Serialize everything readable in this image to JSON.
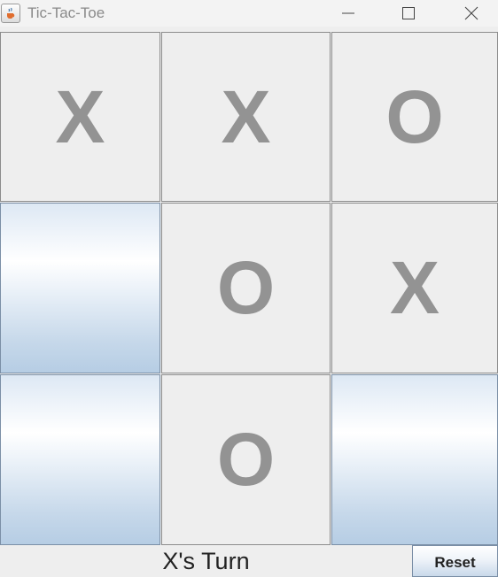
{
  "window": {
    "title": "Tic-Tac-Toe",
    "icon": "java-cup-icon"
  },
  "board": {
    "cells": [
      [
        "X",
        "X",
        "O"
      ],
      [
        "",
        "O",
        "X"
      ],
      [
        "",
        "O",
        ""
      ]
    ]
  },
  "status": {
    "text": "X's Turn"
  },
  "controls": {
    "reset_label": "Reset"
  },
  "colors": {
    "mark": "#939393",
    "empty_cell_gradient_light": "#ffffff",
    "empty_cell_gradient_dark": "#b6cde4",
    "background": "#eeeeee"
  }
}
